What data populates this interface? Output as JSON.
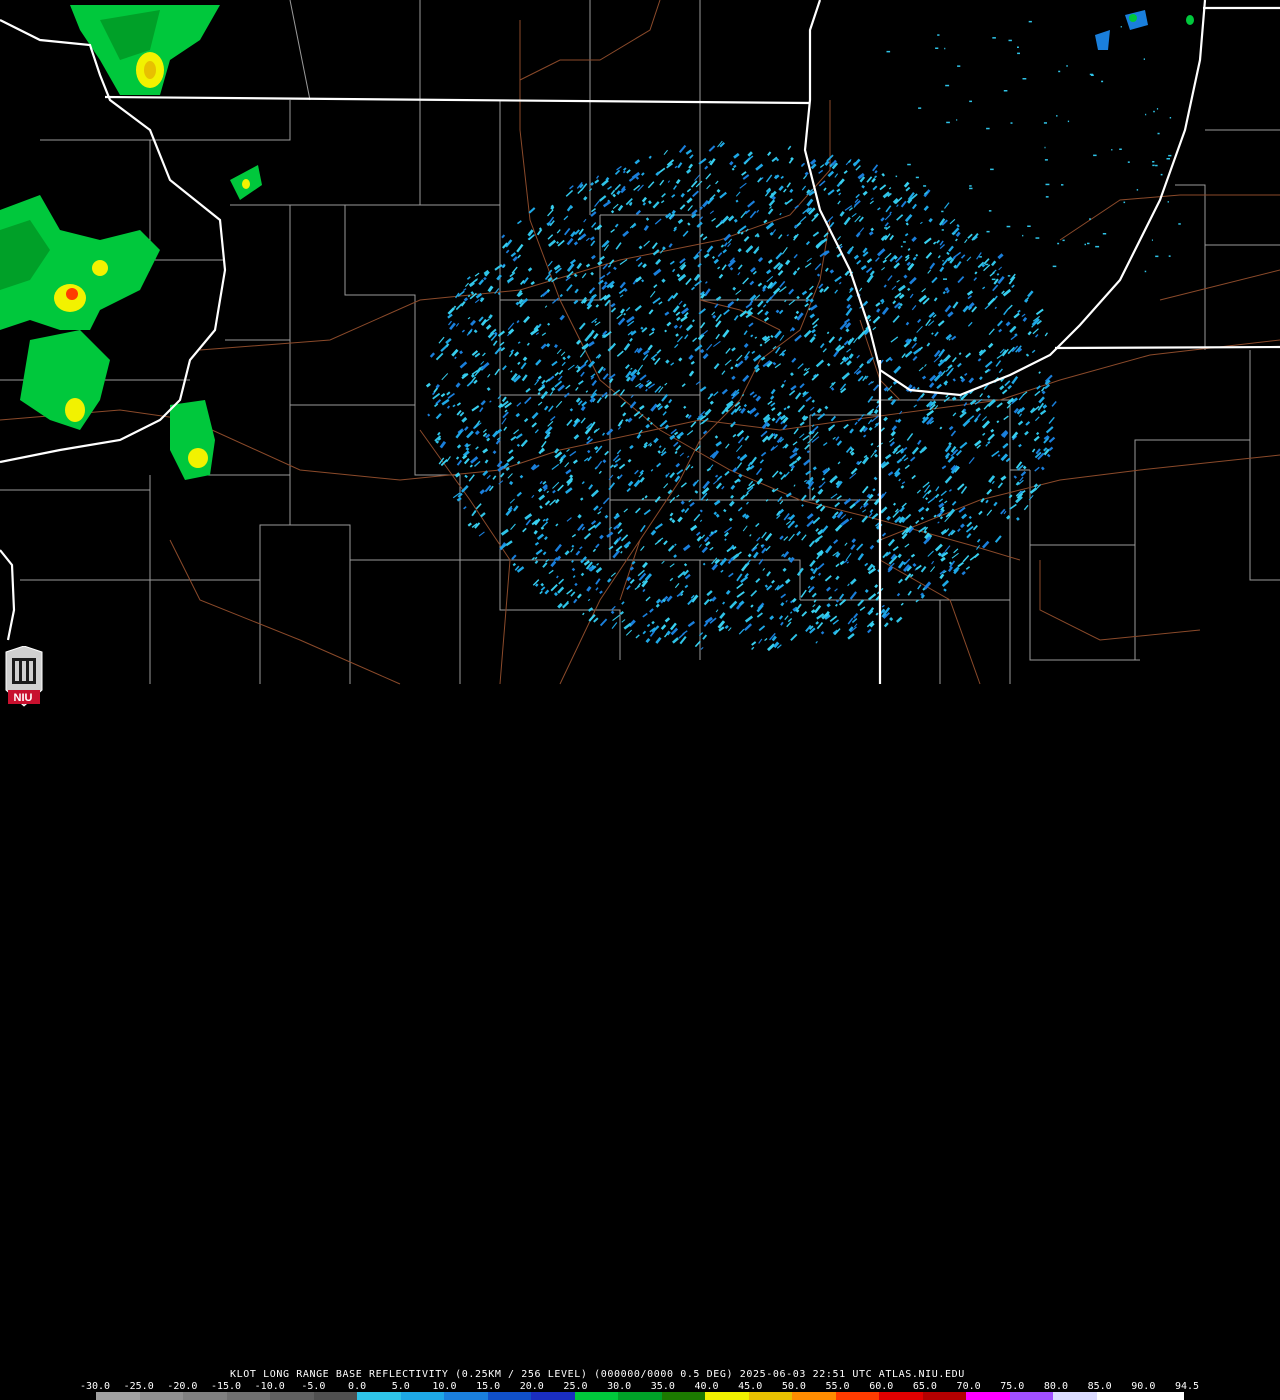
{
  "caption": "KLOT LONG RANGE BASE REFLECTIVITY (0.25KM / 256 LEVEL) (000000/0000 0.5 DEG) 2025-06-03 22:51 UTC  ATLAS.NIU.EDU",
  "logo": {
    "label": "NIU"
  },
  "colorbar": {
    "tick_labels": [
      "-30.0",
      "-25.0",
      "-20.0",
      "-15.0",
      "-10.0",
      "-5.0",
      "0.0",
      "5.0",
      "10.0",
      "15.0",
      "20.0",
      "25.0",
      "30.0",
      "35.0",
      "40.0",
      "45.0",
      "50.0",
      "55.0",
      "60.0",
      "65.0",
      "70.0",
      "75.0",
      "80.0",
      "85.0",
      "90.0",
      "94.5"
    ],
    "segment_colors": [
      "#a0a0a0",
      "#909090",
      "#808080",
      "#707070",
      "#606060",
      "#505050",
      "#2fc4e8",
      "#1ea8e6",
      "#1a7fdc",
      "#1050c8",
      "#1a2ec0",
      "#00c83c",
      "#00a028",
      "#1c7a00",
      "#f2f200",
      "#e8c000",
      "#ff8c00",
      "#ff3c00",
      "#e00000",
      "#b40000",
      "#ff00ff",
      "#a050ff",
      "#dcdcff",
      "#ffffff",
      "#ffffff"
    ]
  },
  "map_colors": {
    "state_border": "#ffffff",
    "county_border": "#9a9a9a",
    "highway": "#8b4a2a",
    "background": "#000000"
  }
}
